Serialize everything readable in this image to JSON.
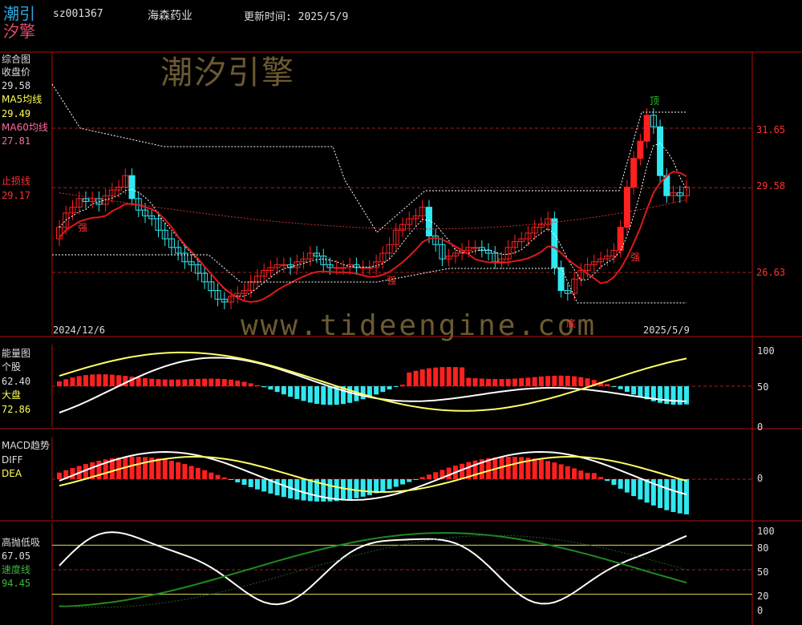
{
  "header": {
    "logo_line1": "潮引",
    "logo_line2": "汐擎",
    "code": "sz001367",
    "name": "海森药业",
    "update_time": "更新时间: 2025/5/9"
  },
  "watermarks": {
    "brand": "潮汐引擎",
    "site": "www.tideengine.com"
  },
  "panel1": {
    "title": "综合图",
    "close_label": "收盘价",
    "close_value": "29.58",
    "ma5_label": "MA5均线",
    "ma5_value": "29.49",
    "ma60_label": "MA60均线",
    "ma60_value": "27.81",
    "stop_label": "止损线",
    "stop_value": "29.17",
    "y_ticks": [
      "31.65",
      "29.58",
      "26.63"
    ],
    "date_start": "2024/12/6",
    "date_end": "2025/5/9",
    "annotations": {
      "top": "顶",
      "bottom": "底",
      "strong": "强"
    }
  },
  "panel2": {
    "title": "能量图",
    "stock_label": "个股",
    "stock_value": "62.40",
    "market_label": "大盘",
    "market_value": "72.86",
    "y_ticks": [
      "100",
      "50",
      "0"
    ]
  },
  "panel3": {
    "title": "MACD趋势",
    "diff_label": "DIFF",
    "dea_label": "DEA",
    "y_ticks": [
      "0"
    ]
  },
  "panel4": {
    "title": "高抛低吸",
    "value": "67.05",
    "speed_label": "速度线",
    "speed_value": "94.45",
    "y_ticks": [
      "100",
      "80",
      "50",
      "20",
      "0"
    ]
  },
  "colors": {
    "up": "#ff2020",
    "down": "#30e8f0",
    "ma5": "#ffffff",
    "stop": "#e01818",
    "ma60": "#d03030",
    "energy_market": "#ffff66",
    "speed": "#1e8a1e",
    "frame": "#b01010"
  },
  "chart_data": [
    {
      "type": "candlestick",
      "title": "综合图",
      "x_range": [
        "2024/12/6",
        "2025/5/9"
      ],
      "y_ticks": [
        31.65,
        29.58,
        26.63
      ],
      "closes": [
        28.2,
        28.7,
        28.9,
        29.2,
        29.1,
        29.2,
        29.0,
        29.3,
        29.5,
        29.6,
        30.0,
        29.2,
        28.8,
        28.6,
        28.5,
        28.1,
        27.8,
        27.5,
        27.3,
        27.0,
        26.9,
        26.6,
        26.3,
        26.0,
        25.7,
        25.6,
        25.8,
        25.9,
        26.0,
        26.3,
        26.5,
        26.7,
        26.8,
        26.9,
        26.9,
        26.8,
        27.0,
        27.1,
        27.3,
        27.2,
        26.9,
        26.8,
        26.8,
        26.8,
        26.9,
        26.8,
        26.8,
        26.8,
        27.0,
        27.3,
        27.6,
        28.1,
        28.3,
        28.5,
        28.6,
        28.9,
        27.9,
        27.6,
        27.1,
        27.2,
        27.3,
        27.4,
        27.5,
        27.5,
        27.4,
        27.3,
        27.0,
        27.1,
        27.5,
        27.7,
        27.8,
        28.0,
        28.2,
        28.3,
        28.5,
        26.8,
        26.0,
        25.9,
        26.4,
        26.7,
        26.9,
        27.0,
        27.1,
        27.2,
        27.4,
        28.2,
        29.6,
        30.6,
        31.2,
        32.1,
        31.7,
        30.0,
        29.3,
        29.4,
        29.3,
        29.6
      ],
      "ma5_last": 29.49,
      "ma60_last": 27.81,
      "stop_last": 29.17
    },
    {
      "type": "bar",
      "title": "能量图",
      "series": [
        {
          "name": "个股",
          "last": 62.4
        },
        {
          "name": "大盘",
          "last": 72.86
        }
      ],
      "ylim": [
        0,
        100
      ]
    },
    {
      "type": "line",
      "title": "MACD趋势",
      "series": [
        {
          "name": "DIFF"
        },
        {
          "name": "DEA"
        }
      ]
    },
    {
      "type": "line",
      "title": "高抛低吸",
      "series": [
        {
          "name": "高抛低吸",
          "last": 67.05
        },
        {
          "name": "速度线",
          "last": 94.45
        }
      ],
      "ylim": [
        0,
        100
      ],
      "reference_lines": [
        80,
        50,
        20
      ]
    }
  ]
}
